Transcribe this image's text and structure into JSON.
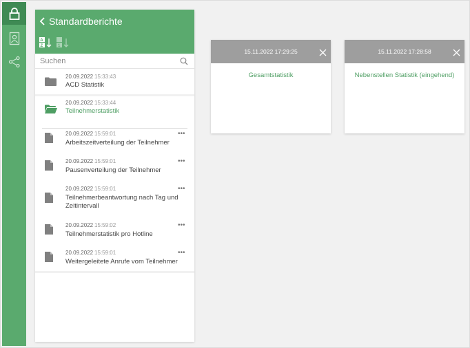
{
  "colors": {
    "brand_green": "#5aaa6e",
    "brand_green_dark": "#3f8a54",
    "accent_text_green": "#4e9e63",
    "card_header_gray": "#9e9e9e"
  },
  "rail": {
    "items": [
      {
        "icon": "lock-icon",
        "active": true
      },
      {
        "icon": "contact-card-icon",
        "active": false
      },
      {
        "icon": "share-icon",
        "active": false
      }
    ]
  },
  "panel": {
    "title": "Standardberichte",
    "search_placeholder": "Suchen",
    "folders": [
      {
        "date": "20.09.2022",
        "time": "15:33:43",
        "name": "ACD Statistik",
        "icon": "folder-icon",
        "open": false
      },
      {
        "date": "20.09.2022",
        "time": "15:33:44",
        "name": "Teilnehmerstatistik",
        "icon": "folder-open-icon",
        "open": true
      }
    ],
    "reports": [
      {
        "date": "20.09.2022",
        "time": "15:59:01",
        "name": "Arbeitszeitverteilung der Teilnehmer"
      },
      {
        "date": "20.09.2022",
        "time": "15:59:01",
        "name": "Pausenverteilung der Teilnehmer"
      },
      {
        "date": "20.09.2022",
        "time": "15:59:01",
        "name": "Teilnehmerbeantwortung nach Tag und Zeitintervall"
      },
      {
        "date": "20.09.2022",
        "time": "15:59:02",
        "name": "Teilnehmerstatistik pro Hotline"
      },
      {
        "date": "20.09.2022",
        "time": "15:59:01",
        "name": "Weitergeleitete Anrufe vom Teilnehmer"
      }
    ],
    "more_label": "•••"
  },
  "cards": [
    {
      "date": "15.11.2022 17:29:25",
      "title": "Gesamtstatistik"
    },
    {
      "date": "15.11.2022 17:28:58",
      "title": "Nebenstellen Statistik (eingehend)"
    }
  ]
}
